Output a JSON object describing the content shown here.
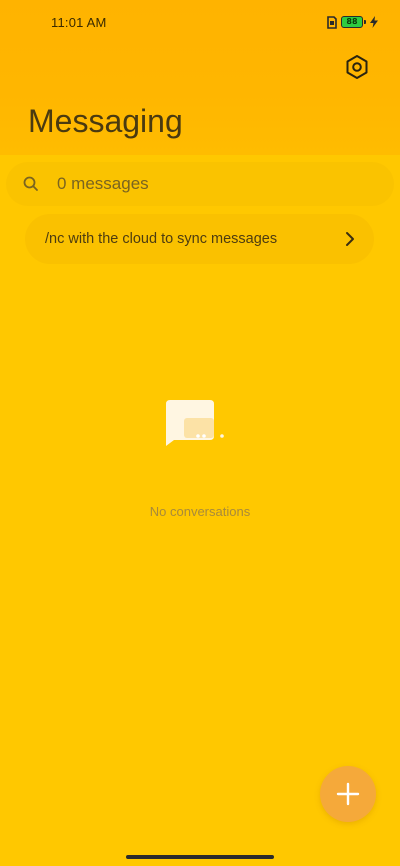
{
  "status_bar": {
    "time": "11:01 AM",
    "battery_level": "88",
    "icons": [
      "sim-icon",
      "battery-icon",
      "charging-icon"
    ]
  },
  "header": {
    "title": "Messaging",
    "settings_icon": "settings-icon"
  },
  "search": {
    "placeholder": "0 messages",
    "value": ""
  },
  "sync_banner": {
    "text": "/nc with the cloud to sync messages"
  },
  "empty_state": {
    "text": "No conversations"
  },
  "fab": {
    "icon": "plus-icon"
  },
  "colors": {
    "background": "#FFC800",
    "header": "#FFB300",
    "fab": "#F5A93A",
    "battery": "#2ecc40"
  }
}
